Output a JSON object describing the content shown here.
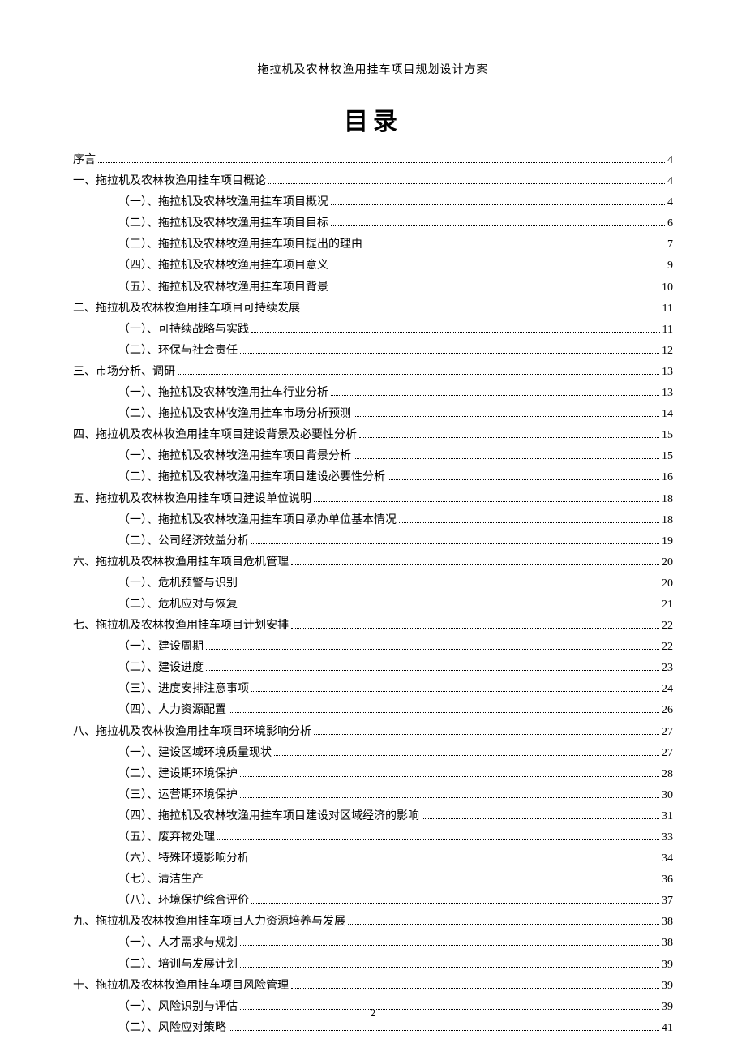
{
  "doc_title": "拖拉机及农林牧渔用挂车项目规划设计方案",
  "main_heading": "目录",
  "page_number": "2",
  "toc": [
    {
      "level": 1,
      "label": "序言",
      "page": "4"
    },
    {
      "level": 1,
      "label": "一、拖拉机及农林牧渔用挂车项目概论",
      "page": "4"
    },
    {
      "level": 2,
      "label": "（一）、拖拉机及农林牧渔用挂车项目概况",
      "page": "4"
    },
    {
      "level": 2,
      "label": "（二）、拖拉机及农林牧渔用挂车项目目标",
      "page": "6"
    },
    {
      "level": 2,
      "label": "（三）、拖拉机及农林牧渔用挂车项目提出的理由",
      "page": "7"
    },
    {
      "level": 2,
      "label": "（四）、拖拉机及农林牧渔用挂车项目意义",
      "page": "9"
    },
    {
      "level": 2,
      "label": "（五）、拖拉机及农林牧渔用挂车项目背景",
      "page": "10"
    },
    {
      "level": 1,
      "label": "二、拖拉机及农林牧渔用挂车项目可持续发展",
      "page": "11"
    },
    {
      "level": 2,
      "label": "（一）、可持续战略与实践",
      "page": "11"
    },
    {
      "level": 2,
      "label": "（二）、环保与社会责任",
      "page": "12"
    },
    {
      "level": 1,
      "label": "三、市场分析、调研",
      "page": "13"
    },
    {
      "level": 2,
      "label": "（一）、拖拉机及农林牧渔用挂车行业分析",
      "page": "13"
    },
    {
      "level": 2,
      "label": "（二）、拖拉机及农林牧渔用挂车市场分析预测",
      "page": "14"
    },
    {
      "level": 1,
      "label": "四、拖拉机及农林牧渔用挂车项目建设背景及必要性分析",
      "page": "15"
    },
    {
      "level": 2,
      "label": "（一）、拖拉机及农林牧渔用挂车项目背景分析",
      "page": "15"
    },
    {
      "level": 2,
      "label": "（二）、拖拉机及农林牧渔用挂车项目建设必要性分析",
      "page": "16"
    },
    {
      "level": 1,
      "label": "五、拖拉机及农林牧渔用挂车项目建设单位说明",
      "page": "18"
    },
    {
      "level": 2,
      "label": "（一）、拖拉机及农林牧渔用挂车项目承办单位基本情况",
      "page": "18"
    },
    {
      "level": 2,
      "label": "（二）、公司经济效益分析",
      "page": "19"
    },
    {
      "level": 1,
      "label": "六、拖拉机及农林牧渔用挂车项目危机管理",
      "page": "20"
    },
    {
      "level": 2,
      "label": "（一）、危机预警与识别",
      "page": "20"
    },
    {
      "level": 2,
      "label": "（二）、危机应对与恢复",
      "page": "21"
    },
    {
      "level": 1,
      "label": "七、拖拉机及农林牧渔用挂车项目计划安排",
      "page": "22"
    },
    {
      "level": 2,
      "label": "（一）、建设周期",
      "page": "22"
    },
    {
      "level": 2,
      "label": "（二）、建设进度",
      "page": "23"
    },
    {
      "level": 2,
      "label": "（三）、进度安排注意事项",
      "page": "24"
    },
    {
      "level": 2,
      "label": "（四）、人力资源配置",
      "page": "26"
    },
    {
      "level": 1,
      "label": "八、拖拉机及农林牧渔用挂车项目环境影响分析",
      "page": "27"
    },
    {
      "level": 2,
      "label": "（一）、建设区域环境质量现状",
      "page": "27"
    },
    {
      "level": 2,
      "label": "（二）、建设期环境保护",
      "page": "28"
    },
    {
      "level": 2,
      "label": "（三）、运营期环境保护",
      "page": "30"
    },
    {
      "level": 2,
      "label": "（四）、拖拉机及农林牧渔用挂车项目建设对区域经济的影响",
      "page": "31"
    },
    {
      "level": 2,
      "label": "（五）、废弃物处理",
      "page": "33"
    },
    {
      "level": 2,
      "label": "（六）、特殊环境影响分析",
      "page": "34"
    },
    {
      "level": 2,
      "label": "（七）、清洁生产",
      "page": "36"
    },
    {
      "level": 2,
      "label": "（八）、环境保护综合评价",
      "page": "37"
    },
    {
      "level": 1,
      "label": "九、拖拉机及农林牧渔用挂车项目人力资源培养与发展",
      "page": "38"
    },
    {
      "level": 2,
      "label": "（一）、人才需求与规划",
      "page": "38"
    },
    {
      "level": 2,
      "label": "（二）、培训与发展计划",
      "page": "39"
    },
    {
      "level": 1,
      "label": "十、拖拉机及农林牧渔用挂车项目风险管理",
      "page": "39"
    },
    {
      "level": 2,
      "label": "（一）、风险识别与评估",
      "page": "39"
    },
    {
      "level": 2,
      "label": "（二）、风险应对策略",
      "page": "41"
    }
  ]
}
